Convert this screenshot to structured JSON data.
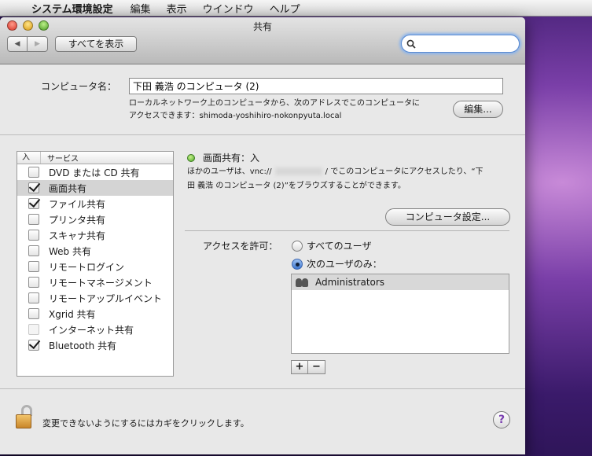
{
  "menubar": {
    "app_name": "システム環境設定",
    "items": [
      "編集",
      "表示",
      "ウインドウ",
      "ヘルプ"
    ]
  },
  "window": {
    "title": "共有",
    "show_all": "すべてを表示",
    "search_placeholder": ""
  },
  "computer_name": {
    "label": "コンピュータ名：",
    "value": "下田 義浩 のコンピュータ (2)",
    "note_line1": "ローカルネットワーク上のコンピュータから、次のアドレスでこのコンピュータに",
    "note_line2": "アクセスできます：shimoda-yoshihiro-nokonpyuta.local",
    "edit_button": "編集..."
  },
  "services": {
    "header_on": "入",
    "header_service": "サービス",
    "items": [
      {
        "label": "DVD または CD 共有",
        "checked": false
      },
      {
        "label": "画面共有",
        "checked": true
      },
      {
        "label": "ファイル共有",
        "checked": true
      },
      {
        "label": "プリンタ共有",
        "checked": false
      },
      {
        "label": "スキャナ共有",
        "checked": false
      },
      {
        "label": "Web 共有",
        "checked": false
      },
      {
        "label": "リモートログイン",
        "checked": false
      },
      {
        "label": "リモートマネージメント",
        "checked": false
      },
      {
        "label": "リモートアップルイベント",
        "checked": false
      },
      {
        "label": "Xgrid 共有",
        "checked": false
      },
      {
        "label": "インターネット共有",
        "checked": false
      },
      {
        "label": "Bluetooth 共有",
        "checked": true
      }
    ]
  },
  "detail": {
    "status": "画面共有：入",
    "desc_prefix": "ほかのユーザは、vnc://",
    "desc_suffix": "/ でこのコンピュータにアクセスしたり、“下",
    "desc_line2": "田 義浩 のコンピュータ (2)”をブラウズすることができます。",
    "computer_settings_button": "コンピュータ設定...",
    "access_label": "アクセスを許可：",
    "radio_all": "すべてのユーザ",
    "radio_only": "次のユーザのみ：",
    "users": [
      "Administrators"
    ],
    "add_label": "+",
    "remove_label": "−"
  },
  "footer": {
    "lock_text": "変更できないようにするにはカギをクリックします。",
    "help_label": "?"
  }
}
